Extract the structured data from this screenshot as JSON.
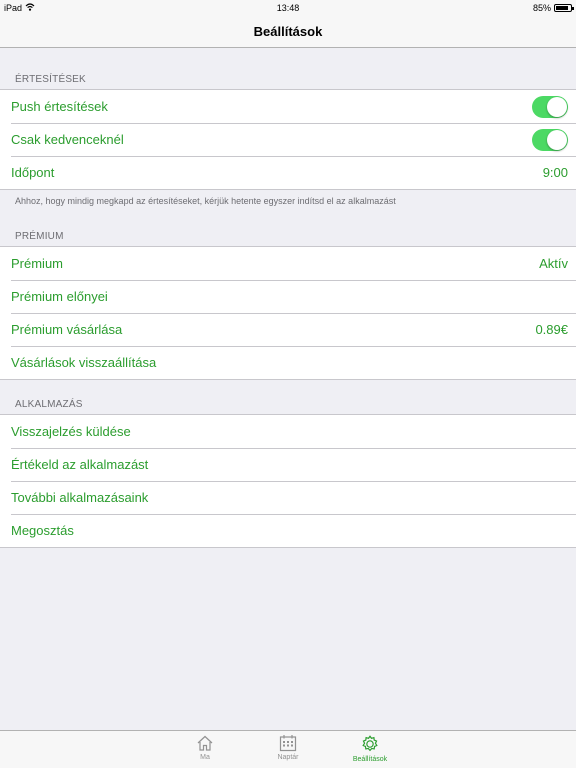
{
  "status_bar": {
    "device": "iPad",
    "time": "13:48",
    "battery": "85%",
    "battery_level": 0.85
  },
  "nav": {
    "title": "Beállítások"
  },
  "sections": {
    "notifications": {
      "header": "ÉRTESÍTÉSEK",
      "rows": [
        {
          "label": "Push értesítések",
          "toggle": true
        },
        {
          "label": "Csak kedvenceknél",
          "toggle": true
        },
        {
          "label": "Időpont",
          "value": "9:00"
        }
      ],
      "footnote": "Ahhoz, hogy mindig megkapd az értesítéseket, kérjük hetente egyszer indítsd el az alkalmazást"
    },
    "premium": {
      "header": "PRÉMIUM",
      "rows": [
        {
          "label": "Prémium",
          "value": "Aktív"
        },
        {
          "label": "Prémium előnyei"
        },
        {
          "label": "Prémium vásárlása",
          "value": "0.89€"
        },
        {
          "label": "Vásárlások visszaállítása"
        }
      ]
    },
    "app": {
      "header": "ALKALMAZÁS",
      "rows": [
        {
          "label": "Visszajelzés küldése"
        },
        {
          "label": "Értékeld az alkalmazást"
        },
        {
          "label": "További alkalmazásaink"
        },
        {
          "label": "Megosztás"
        }
      ]
    }
  },
  "tabs": [
    {
      "label": "Ma",
      "icon": "house-icon",
      "active": false
    },
    {
      "label": "Naptár",
      "icon": "calendar-icon",
      "active": false
    },
    {
      "label": "Beállítások",
      "icon": "gear-icon",
      "active": true
    }
  ],
  "colors": {
    "accent": "#2b9d2e",
    "toggle_on": "#4cd964",
    "background": "#efeff4"
  }
}
